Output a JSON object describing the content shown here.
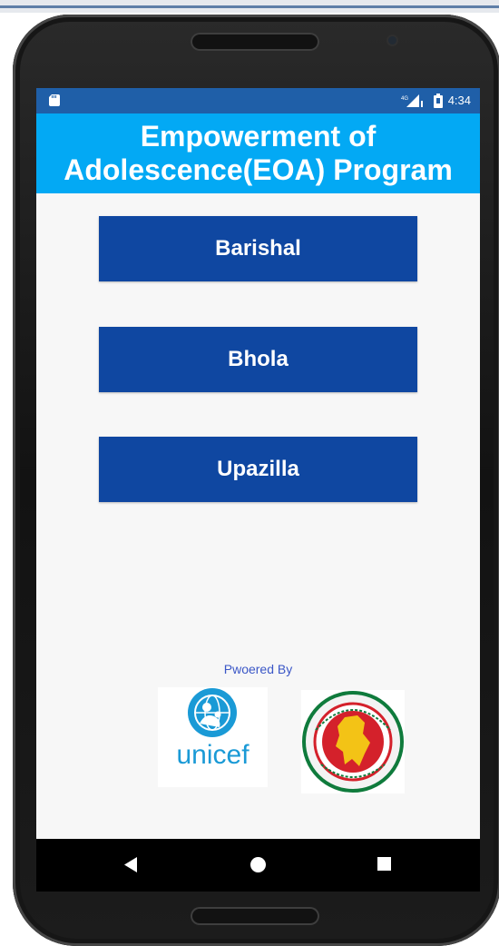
{
  "status_bar": {
    "network": "4G",
    "time": "4:34"
  },
  "app": {
    "title": "Empowerment of\nAdolescence(EOA) Program"
  },
  "buttons": [
    {
      "label": "Barishal"
    },
    {
      "label": "Bhola"
    },
    {
      "label": "Upazilla"
    }
  ],
  "footer": {
    "powered_by": "Pwoered By",
    "unicef_logo_text": "unicef"
  },
  "navigation": {
    "back_icon": "back-triangle-icon",
    "home_icon": "home-circle-icon",
    "recents_icon": "recents-square-icon"
  },
  "colors": {
    "status_bar": "#1f5fa8",
    "header": "#03a9f4",
    "button": "#0f47a1",
    "powered_by_text": "#3b57c7"
  }
}
